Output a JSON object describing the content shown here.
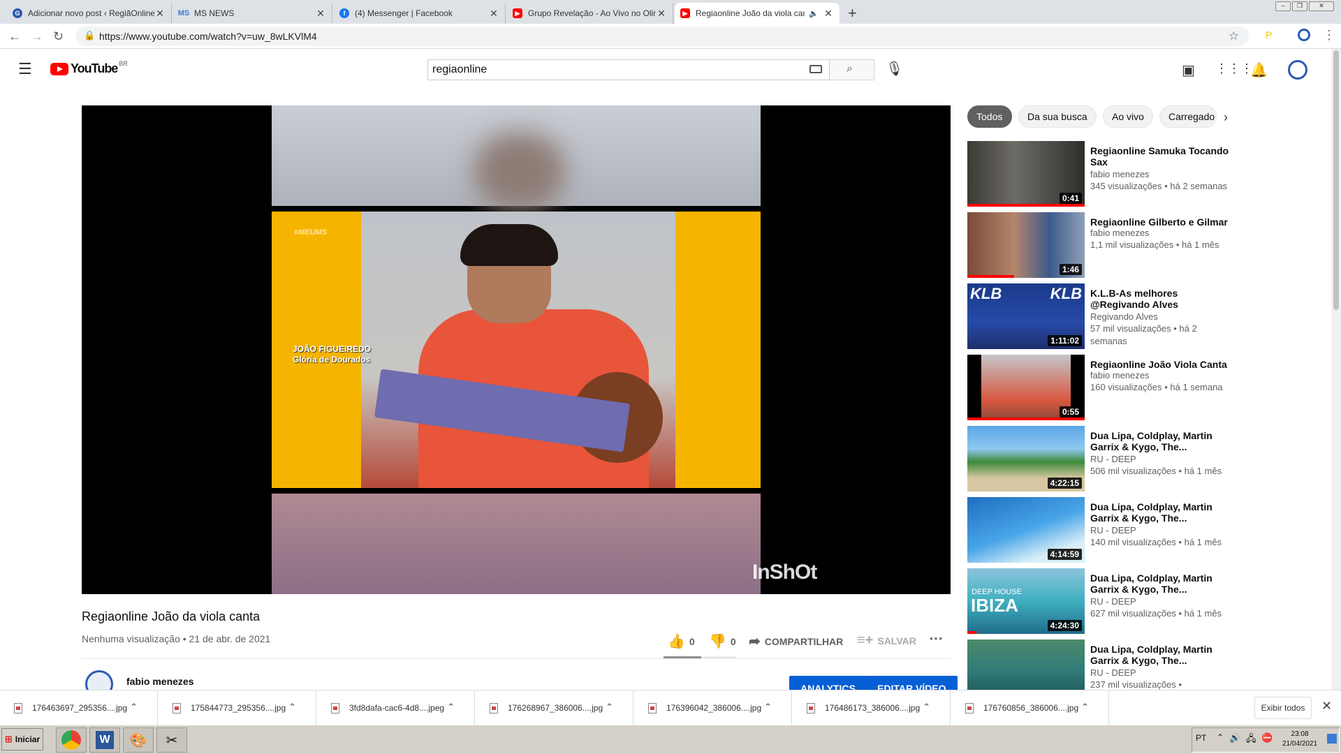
{
  "browser": {
    "tabs": [
      {
        "label": "Adicionar novo post ‹ RegiãOnline –",
        "favicon": "regiaonline-icon",
        "color": "#2a5ab0"
      },
      {
        "label": "MS NEWS",
        "favicon": "ms-news-icon",
        "color": "#3a7bd5"
      },
      {
        "label": "(4) Messenger | Facebook",
        "favicon": "facebook-icon",
        "color": "#1877f2"
      },
      {
        "label": "Grupo Revelação - Ao Vivo no Olimp",
        "favicon": "youtube-icon",
        "color": "#ff0000"
      },
      {
        "label": "Regiaonline João da viola canta",
        "favicon": "youtube-icon",
        "color": "#ff0000",
        "active": true
      }
    ],
    "url": "https://www.youtube.com/watch?v=uw_8wLKVlM4"
  },
  "youtube": {
    "logo_text": "YouTube",
    "country": "BR",
    "search_value": "regiaonline"
  },
  "video": {
    "title": "Regiaonline João da viola canta",
    "meta": "Nenhuma visualização • 21 de abr. de 2021",
    "likes": "0",
    "dislikes": "0",
    "share_label": "COMPARTILHAR",
    "save_label": "SALVAR",
    "overlay_tag": "#MEUMS",
    "overlay_name": "JOÃO FIGUEIREDO",
    "overlay_place": "Glória de Dourados",
    "watermark": "InShOt"
  },
  "channel": {
    "name": "fabio menezes",
    "analytics_label": "ANALYTICS",
    "edit_label": "EDITAR VÍDEO"
  },
  "chips": [
    "Todos",
    "Da sua busca",
    "Ao vivo",
    "Carregado"
  ],
  "related": [
    {
      "title": "Regiaonline Samuka Tocando Sax",
      "channel": "fabio menezes",
      "stats": "345 visualizações • há 2 semanas",
      "duration": "0:41",
      "progress": 1.0
    },
    {
      "title": "Regiaonline Gilberto e Gilmar",
      "channel": "fabio menezes",
      "stats": "1,1 mil visualizações • há 1 mês",
      "duration": "1:46",
      "progress": 0.4
    },
    {
      "title": "K.L.B-As melhores @Regivando Alves",
      "channel": "Regivando Alves",
      "stats": "57 mil visualizações • há 2 semanas",
      "duration": "1:11:02",
      "progress": 0.0
    },
    {
      "title": "Regiaonline João Viola Canta",
      "channel": "fabio menezes",
      "stats": "160 visualizações • há 1 semana",
      "duration": "0:55",
      "progress": 1.0
    },
    {
      "title": "Dua Lipa, Coldplay, Martin Garrix & Kygo, The...",
      "channel": "RU - DEEP",
      "stats": "506 mil visualizações • há 1 mês",
      "duration": "4:22:15",
      "progress": 0.0
    },
    {
      "title": "Dua Lipa, Coldplay, Martin Garrix & Kygo, The...",
      "channel": "RU - DEEP",
      "stats": "140 mil visualizações • há 1 mês",
      "duration": "4:14:59",
      "progress": 0.0
    },
    {
      "title": "Dua Lipa, Coldplay, Martin Garrix & Kygo, The...",
      "channel": "RU - DEEP",
      "stats": "627 mil visualizações • há 1 mês",
      "duration": "4:24:30",
      "progress": 0.08
    },
    {
      "title": "Dua Lipa, Coldplay, Martin Garrix & Kygo, The...",
      "channel": "RU - DEEP",
      "stats": "237 mil visualizações •",
      "duration": "",
      "progress": 0.0
    }
  ],
  "downloads": {
    "items": [
      "176463697_295356....jpg",
      "175844773_295356....jpg",
      "3fd8dafa-cac6-4d8....jpeg",
      "176268967_386006....jpg",
      "176396042_386006....jpg",
      "176486173_386006....jpg",
      "176760856_386006....jpg"
    ],
    "show_all": "Exibir todos"
  },
  "taskbar": {
    "start_label": "Iniciar",
    "language": "PT",
    "time": "23:08",
    "date": "21/04/2021"
  }
}
